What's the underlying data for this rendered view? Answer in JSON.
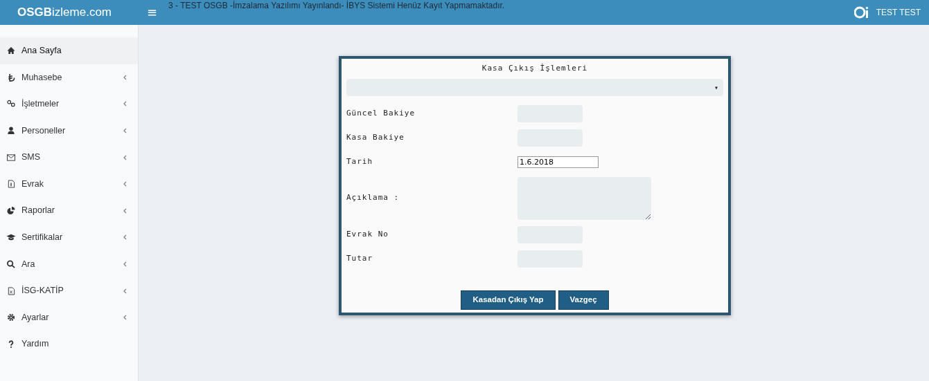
{
  "header": {
    "logo_bold": "OSGB",
    "logo_rest": "izleme.com",
    "menu_toggle": "≡",
    "marquee": "3 - TEST OSGB -İmzalama Yazılımı Yayınlandı- İBYS Sistemi Henüz Kayıt Yapmamaktadır.",
    "user": "TEST TEST"
  },
  "sidebar": {
    "items": [
      {
        "label": "Ana Sayfa",
        "selected": true,
        "expandable": false
      },
      {
        "label": "Muhasebe",
        "selected": false,
        "expandable": true
      },
      {
        "label": "İşletmeler",
        "selected": false,
        "expandable": true
      },
      {
        "label": "Personeller",
        "selected": false,
        "expandable": true
      },
      {
        "label": "SMS",
        "selected": false,
        "expandable": true
      },
      {
        "label": "Evrak",
        "selected": false,
        "expandable": true
      },
      {
        "label": "Raporlar",
        "selected": false,
        "expandable": true
      },
      {
        "label": "Sertifikalar",
        "selected": false,
        "expandable": true
      },
      {
        "label": "Ara",
        "selected": false,
        "expandable": true
      },
      {
        "label": "İSG-KATİP",
        "selected": false,
        "expandable": true
      },
      {
        "label": "Ayarlar",
        "selected": false,
        "expandable": true
      },
      {
        "label": "Yardım",
        "selected": false,
        "expandable": false
      }
    ]
  },
  "dialog": {
    "title": "Kasa Çıkış İşlemleri",
    "select_caret": "▾",
    "fields": [
      {
        "label": "Güncel Bakiye",
        "kind": "short"
      },
      {
        "label": "Kasa Bakiye",
        "kind": "short"
      },
      {
        "label": "Tarih",
        "kind": "date",
        "value": "1.6.2018"
      },
      {
        "label": "Açıklama :",
        "kind": "textarea"
      },
      {
        "label": "Evrak No",
        "kind": "short"
      },
      {
        "label": "Tutar",
        "kind": "short"
      }
    ],
    "buttons": [
      "Kasadan Çıkış Yap",
      "Vazgeç"
    ]
  }
}
